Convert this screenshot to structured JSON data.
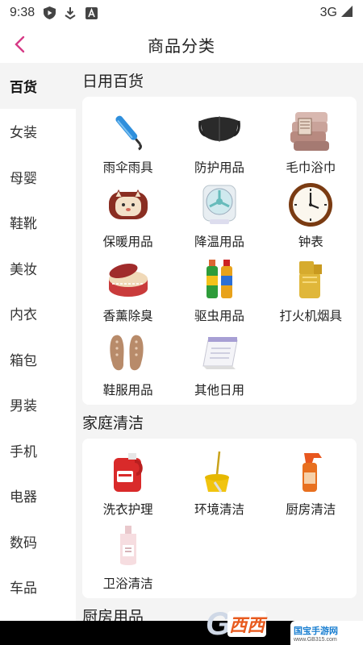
{
  "status": {
    "time": "9:38",
    "network": "3G"
  },
  "header": {
    "title": "商品分类"
  },
  "sidebar": {
    "items": [
      {
        "label": "百货"
      },
      {
        "label": "女装"
      },
      {
        "label": "母婴"
      },
      {
        "label": "鞋靴"
      },
      {
        "label": "美妆"
      },
      {
        "label": "内衣"
      },
      {
        "label": "箱包"
      },
      {
        "label": "男装"
      },
      {
        "label": "手机"
      },
      {
        "label": "电器"
      },
      {
        "label": "数码"
      },
      {
        "label": "车品"
      }
    ]
  },
  "sections": [
    {
      "title": "日用百货",
      "items": [
        {
          "label": "雨伞雨具",
          "icon": "umbrella-icon"
        },
        {
          "label": "防护用品",
          "icon": "face-mask-icon"
        },
        {
          "label": "毛巾浴巾",
          "icon": "towel-icon"
        },
        {
          "label": "保暖用品",
          "icon": "hand-warmer-icon"
        },
        {
          "label": "降温用品",
          "icon": "fan-icon"
        },
        {
          "label": "钟表",
          "icon": "clock-icon"
        },
        {
          "label": "香薰除臭",
          "icon": "aroma-tin-icon"
        },
        {
          "label": "驱虫用品",
          "icon": "insect-spray-icon"
        },
        {
          "label": "打火机烟具",
          "icon": "lighter-icon"
        },
        {
          "label": "鞋服用品",
          "icon": "insoles-icon"
        },
        {
          "label": "其他日用",
          "icon": "desk-calendar-icon"
        }
      ]
    },
    {
      "title": "家庭清洁",
      "items": [
        {
          "label": "洗衣护理",
          "icon": "laundry-detergent-icon"
        },
        {
          "label": "环境清洁",
          "icon": "mop-bucket-icon"
        },
        {
          "label": "厨房清洁",
          "icon": "spray-cleaner-icon"
        },
        {
          "label": "卫浴清洁",
          "icon": "body-wash-bottle-icon"
        }
      ]
    },
    {
      "title": "厨房用品",
      "items": []
    }
  ],
  "watermark": {
    "logo_text": "西西",
    "site_name": "国宝手游网",
    "site_url": "www.GB315.com"
  }
}
